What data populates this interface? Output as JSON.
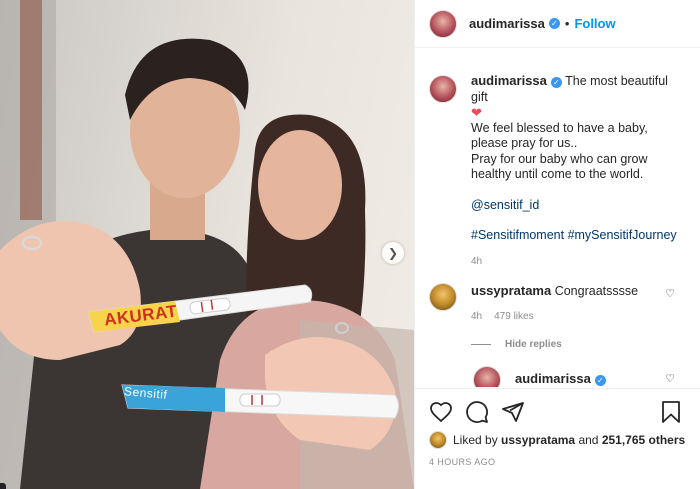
{
  "photo": {
    "test_labels": [
      "AKURAT",
      "Sensitif"
    ],
    "next_icon": "chevron-right-icon"
  },
  "header": {
    "username": "audimarissa",
    "separator": "•",
    "follow_label": "Follow"
  },
  "caption": {
    "username": "audimarissa",
    "title": "The most beautiful gift",
    "heart": "❤",
    "lines": [
      "We feel blessed to have a baby,",
      "please pray for us..",
      "Pray for our baby who can grow",
      "healthy until come to the world."
    ],
    "mention": "@sensitif_id",
    "hashtags": "#Sensitifmoment #mySensitifJourney",
    "time": "4h"
  },
  "comments": [
    {
      "username": "ussypratama",
      "text": "Congraatsssse",
      "time": "4h",
      "likes": "479 likes",
      "hide_replies": "Hide replies",
      "reply_username": "audimarissa"
    }
  ],
  "actions": {
    "icons": [
      "heart-icon",
      "comment-icon",
      "share-icon",
      "bookmark-icon"
    ],
    "liked_by_prefix": "Liked by",
    "liked_by_user": "ussypratama",
    "liked_by_middle": "and",
    "liked_by_count": "251,765 others",
    "timestamp": "4 HOURS AGO"
  },
  "colors": {
    "accent": "#0095f6",
    "verified": "#3897f0",
    "link": "#00376b",
    "heart": "#ed4956",
    "muted": "#8e8e8e"
  }
}
